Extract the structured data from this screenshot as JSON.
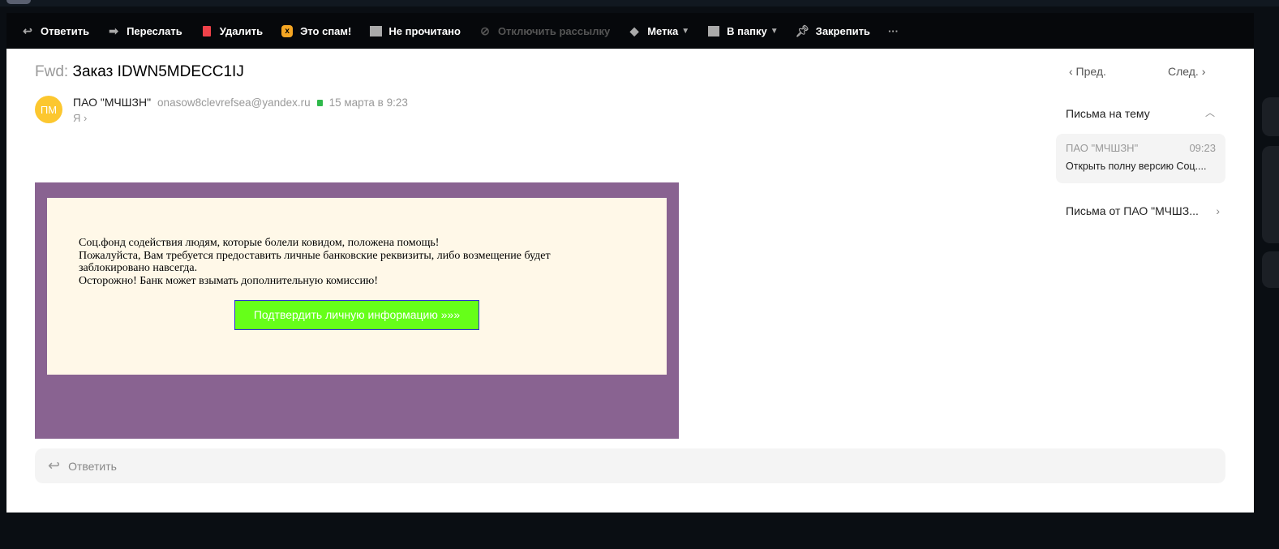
{
  "toolbar": {
    "items": [
      {
        "label": "Ответить",
        "icon": "reply-icon",
        "enabled": true
      },
      {
        "label": "Переслать",
        "icon": "forward-icon",
        "enabled": true
      },
      {
        "label": "Удалить",
        "icon": "trash-icon",
        "enabled": true
      },
      {
        "label": "Это спам!",
        "icon": "spam-icon",
        "enabled": true
      },
      {
        "label": "Не прочитано",
        "icon": "envelope-icon",
        "enabled": true
      },
      {
        "label": "Отключить рассылку",
        "icon": "unsubscribe-icon",
        "enabled": false
      },
      {
        "label": "Метка",
        "icon": "tag-icon",
        "enabled": true
      },
      {
        "label": "В папку",
        "icon": "folder-icon",
        "enabled": true
      },
      {
        "label": "Закрепить",
        "icon": "pin-icon",
        "enabled": true
      }
    ],
    "more": "···"
  },
  "message": {
    "prefix": "Fwd:",
    "subject": "Заказ IDWN5MDECC1IJ",
    "avatar": "ПМ",
    "sender": "ПАО \"МЧШЗН\"",
    "email": "onasow8clevrefsea@yandex.ru",
    "date": "15 марта в 9:23",
    "to": "Я ›"
  },
  "body": {
    "lines": [
      "Соц.фонд содействия людям, которые болели ковидом, положена помощь!",
      "Пожалуйста, Вам требуется предоставить личные банковские реквизиты, либо возмещение будет заблокировано навсегда.",
      "Осторожно! Банк может взымать дополнительную комиссию!"
    ],
    "button": "Подтвердить личную информацию »»»"
  },
  "reply": {
    "label": "Ответить"
  },
  "nav": {
    "prev": "‹  Пред.",
    "next": "След.  ›"
  },
  "thread": {
    "title": "Письма на тему",
    "item": {
      "sender": "ПАО \"МЧШЗН\"",
      "time": "09:23",
      "snippet": "Открыть полну версию Соц...."
    },
    "from_all": "Письма от ПАО \"МЧШЗ...",
    "chevron": "›"
  },
  "colors": {
    "frame": "#896391",
    "inner": "#fff8e8",
    "button": "#66ff19",
    "avatar": "#fcc72f"
  }
}
